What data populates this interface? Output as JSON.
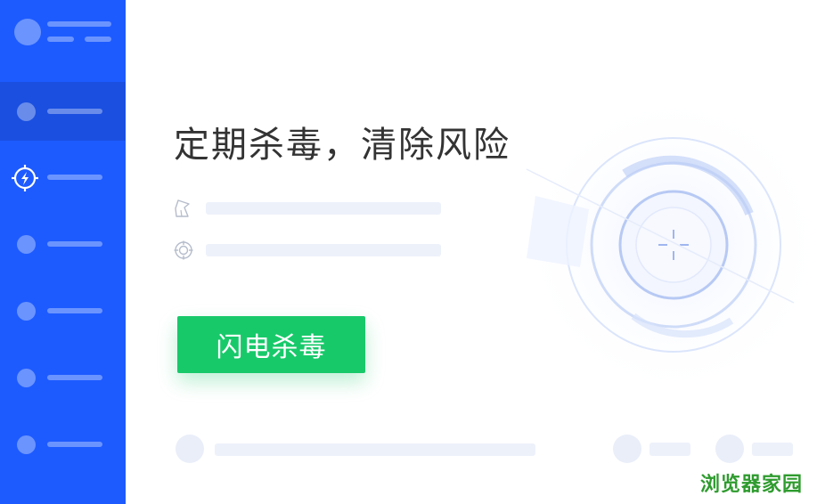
{
  "main": {
    "headline": "定期杀毒，清除风险",
    "primary_button_label": "闪电杀毒"
  },
  "watermark": {
    "text": "浏览器家园"
  },
  "icons": {
    "active_nav": "lightning-target-icon",
    "row_1": "broom-icon",
    "row_2": "crosshair-icon"
  },
  "colors": {
    "sidebar": "#1d5bff",
    "sidebar_active": "#1a4fe0",
    "primary_button": "#18c96a",
    "title_text": "#333333",
    "skeleton": "#edf1fa",
    "watermark": "#2e9b2e"
  }
}
